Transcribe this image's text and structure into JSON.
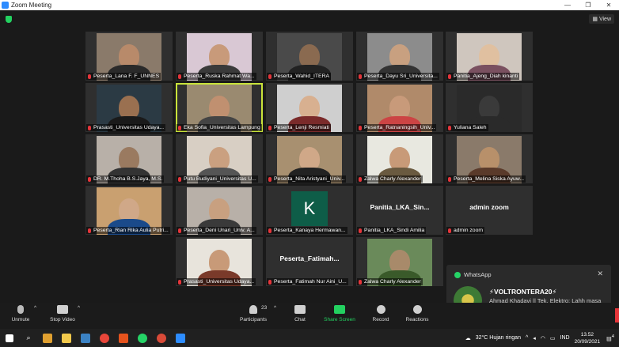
{
  "window": {
    "title": "Zoom Meeting",
    "min": "—",
    "max": "❐",
    "close": "✕"
  },
  "view_label": "View",
  "tiles": [
    {
      "name": "Peserta_Lana F. F_UNNES",
      "bg": "#8a7a6a",
      "skin": "#b88a6a",
      "shirt": "#2a2a2a"
    },
    {
      "name": "Peserta_Ruska Rahmat Wa...",
      "bg": "#d9c8d4",
      "skin": "#c89a7a",
      "shirt": "#3a3a3a"
    },
    {
      "name": "Peserta_Wahid_ITERA",
      "bg": "#4a4a4a",
      "skin": "#8a6a50",
      "shirt": "#222"
    },
    {
      "name": "Peserta_Dayu Sri_Universita...",
      "bg": "#8c8c8c",
      "skin": "#c8a080",
      "shirt": "#333"
    },
    {
      "name": "Panitia_Ajeng_Diah kinanti",
      "bg": "#cfc6be",
      "skin": "#e0c0a0",
      "shirt": "#7a5060"
    },
    {
      "name": "Prasasti_Universitas Udaya...",
      "bg": "#2b3a44",
      "skin": "#9a7050",
      "shirt": "#1a1a1a"
    },
    {
      "name": "Eka Sofia_Universitas Lampung",
      "bg": "#9a8a70",
      "skin": "#c09070",
      "shirt": "#444"
    },
    {
      "name": "Peserta_Lenji Resmiati",
      "bg": "#cfcfcf",
      "skin": "#d8b090",
      "shirt": "#7a2a2a"
    },
    {
      "name": "Peserta_Ratnaningsih_Univ...",
      "bg": "#b08a6a",
      "skin": "#c89a7a",
      "shirt": "#c44"
    },
    {
      "name": "Yuliana Saleh",
      "bg": "#2a2a2a",
      "skin": "#3a3a3a",
      "shirt": "#2a2a2a"
    },
    {
      "name": "DR. M.Thoha B.S.Jaya, M.S.",
      "bg": "#b8b0a8",
      "skin": "#9a7a60",
      "shirt": "#333"
    },
    {
      "name": "Putu Budiyani_Universitas U...",
      "bg": "#d8cfc4",
      "skin": "#caa080",
      "shirt": "#555"
    },
    {
      "name": "Peserta_Nita Aristyani_Univ...",
      "bg": "#a89070",
      "skin": "#d0a888",
      "shirt": "#222"
    },
    {
      "name": "Zalwa Charly Alexander",
      "bg": "#e8e8e0",
      "skin": "#c89a78",
      "shirt": "#6a5a40"
    },
    {
      "name": "Peserta_Melina Siska Ayuw...",
      "bg": "#8a7a6a",
      "skin": "#b8906a",
      "shirt": "#5a3a2a"
    },
    {
      "name": "Peserta_Rian Rika Aulia Putri...",
      "bg": "#c9a070",
      "skin": "#d0a888",
      "shirt": "#1a4a8a"
    },
    {
      "name": "Peserta_Deni Unari_Univ. A...",
      "bg": "#b8b0a8",
      "skin": "#c8a080",
      "shirt": "#3a3a3a"
    },
    {
      "name": "Peserta_Kanaya Hermawan...",
      "avatar": "K"
    },
    {
      "name": "Panitia_LKA_Sindi Amilia",
      "big": "Panitia_LKA_Sin..."
    },
    {
      "name": "admin zoom",
      "big": "admin zoom"
    },
    {
      "name": "Prasasti_Universitas Udaya...",
      "bg": "#e8e4dc",
      "skin": "#c89a78",
      "shirt": "#7a3a2a"
    },
    {
      "name": "Peserta_Fatimah Nur Aini_U...",
      "big": "Peserta_Fatimah..."
    },
    {
      "name": "Zalwa Charly Alexander",
      "bg": "#6a8a5a",
      "skin": "#a88a6a",
      "shirt": "#3a5a2a"
    }
  ],
  "notification": {
    "app": "WhatsApp",
    "title": "⚡VOLTRONTERA20⚡",
    "message": "Ahmad Khadavi || Tek. Elektro: Lahh masa iya"
  },
  "toolbar": {
    "unmute": "Unmute",
    "stop_video": "Stop Video",
    "participants": "Participants",
    "participants_count": "23",
    "chat": "Chat",
    "share_screen": "Share Screen",
    "record": "Record",
    "reactions": "Reactions"
  },
  "taskbar": {
    "weather": "32°C Hujan ringan",
    "lang": "IND",
    "time": "13.52",
    "date": "20/09/2021",
    "notif_count": "4"
  }
}
